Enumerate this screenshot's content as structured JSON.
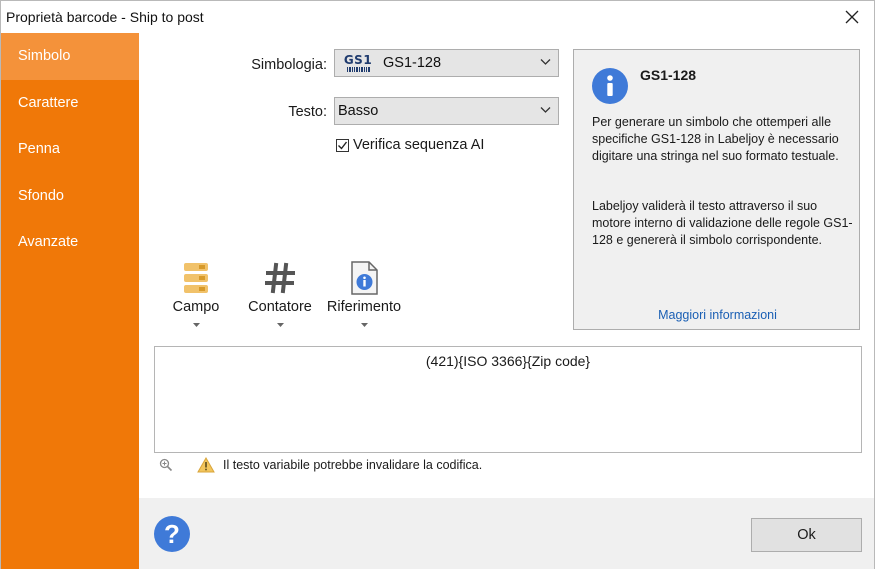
{
  "window": {
    "title": "Proprietà barcode - Ship to post"
  },
  "sidebar": {
    "items": [
      {
        "label": "Simbolo",
        "active": true
      },
      {
        "label": "Carattere"
      },
      {
        "label": "Penna"
      },
      {
        "label": "Sfondo"
      },
      {
        "label": "Avanzate"
      }
    ]
  },
  "form": {
    "symbology_label": "Simbologia:",
    "symbology_value": "GS1-128",
    "symbology_logo": "GS1",
    "text_label": "Testo:",
    "text_value": "Basso",
    "verify_label": "Verifica sequenza AI",
    "verify_checked": true
  },
  "info": {
    "title": "GS1-128",
    "paragraph1": "Per generare un simbolo che ottemperi alle specifiche GS1-128 in Labeljoy è necessario digitare una stringa nel suo formato testuale.",
    "paragraph2": "Labeljoy validerà il testo attraverso il suo motore interno di validazione delle regole GS1-128 e genererà il simbolo corrispondente.",
    "link": "Maggiori informazioni"
  },
  "toolbar": {
    "campo": "Campo",
    "contatore": "Contatore",
    "riferimento": "Riferimento"
  },
  "editor": {
    "text": "(421){ISO 3366}{Zip code}"
  },
  "warning": {
    "text": "Il testo variabile potrebbe invalidare la codifica."
  },
  "footer": {
    "ok_label": "Ok"
  },
  "colors": {
    "sidebar": "#f07808",
    "sidebar_active": "#f4923a",
    "info_blue": "#3f7ad8"
  }
}
